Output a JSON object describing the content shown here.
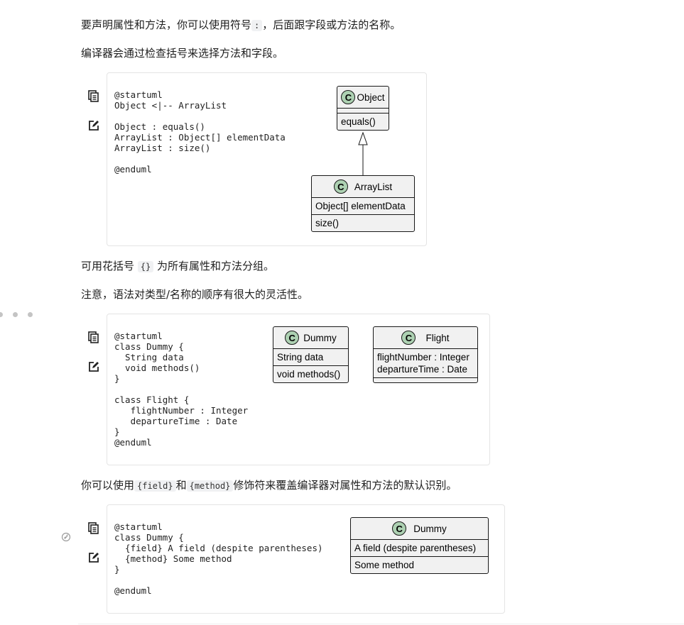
{
  "paragraphs": {
    "p1_before": "要声明属性和方法，你可以使用符号",
    "p1_code": ":",
    "p1_after": "，后面跟字段或方法的名称。",
    "p2": "编译器会通过检查括号来选择方法和字段。",
    "p3_before": "可用花括号",
    "p3_code": "{}",
    "p3_after": "为所有属性和方法分组。",
    "p4": "注意，语法对类型/名称的顺序有很大的灵活性。",
    "p5_before": "你可以使用",
    "p5_code1": "{field}",
    "p5_mid": "和",
    "p5_code2": "{method}",
    "p5_after": "修饰符来覆盖编译器对属性和方法的默认识别。"
  },
  "icons": {
    "copy": "copy-icon",
    "edit": "edit-icon",
    "anchor": "link-anchor-icon",
    "dots": "more-dots-icon"
  },
  "examples": [
    {
      "code": "@startuml\nObject <|-- ArrayList\n\nObject : equals()\nArrayList : Object[] elementData\nArrayList : size()\n\n@enduml",
      "classes": [
        {
          "name": "Object",
          "stereotype": "C",
          "fields": [],
          "methods": [
            "equals()"
          ]
        },
        {
          "name": "ArrayList",
          "stereotype": "C",
          "fields": [
            "Object[] elementData"
          ],
          "methods": [
            "size()"
          ]
        }
      ],
      "relation": {
        "from": "ArrayList",
        "to": "Object",
        "type": "inheritance"
      }
    },
    {
      "code": "@startuml\nclass Dummy {\n  String data\n  void methods()\n}\n\nclass Flight {\n   flightNumber : Integer\n   departureTime : Date\n}\n@enduml",
      "classes": [
        {
          "name": "Dummy",
          "stereotype": "C",
          "fields": [
            "String data"
          ],
          "methods": [
            "void methods()"
          ]
        },
        {
          "name": "Flight",
          "stereotype": "C",
          "fields": [
            "flightNumber : Integer",
            "departureTime : Date"
          ],
          "methods": []
        }
      ]
    },
    {
      "code": "@startuml\nclass Dummy {\n  {field} A field (despite parentheses)\n  {method} Some method\n}\n\n@enduml",
      "classes": [
        {
          "name": "Dummy",
          "stereotype": "C",
          "fields": [
            "A field (despite parentheses)"
          ],
          "methods": [
            "Some method"
          ]
        }
      ]
    }
  ],
  "colors": {
    "class_fill": "#f1f1f1",
    "class_border": "#181818",
    "stereotype_circle": "#add1b2",
    "inline_code_bg": "#f0f1f3"
  }
}
